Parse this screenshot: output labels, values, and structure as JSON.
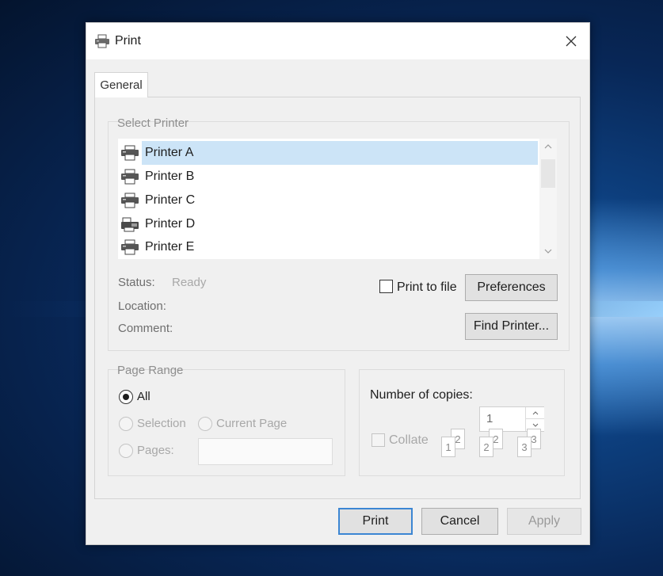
{
  "window": {
    "title": "Print",
    "icon": "printer-icon",
    "close_icon": "close-icon"
  },
  "tabs": [
    {
      "label": "General",
      "active": true
    }
  ],
  "select_printer": {
    "label": "Select Printer",
    "printers": [
      {
        "name": "Printer A",
        "selected": true
      },
      {
        "name": "Printer B",
        "selected": false
      },
      {
        "name": "Printer C",
        "selected": false
      },
      {
        "name": "Printer D",
        "selected": false
      },
      {
        "name": "Printer E",
        "selected": false
      }
    ],
    "status_label": "Status:",
    "status_value": "Ready",
    "location_label": "Location:",
    "comment_label": "Comment:",
    "print_to_file_label": "Print to file",
    "print_to_file_checked": false,
    "preferences_label": "Preferences",
    "find_printer_label": "Find Printer..."
  },
  "page_range": {
    "label": "Page Range",
    "all_label": "All",
    "selection_label": "Selection",
    "current_page_label": "Current Page",
    "pages_label": "Pages:",
    "selected": "All"
  },
  "copies": {
    "label": "Number of copies:",
    "value": "1",
    "collate_label": "Collate",
    "collate_checked": false,
    "collate_pages": [
      [
        "1",
        "2"
      ],
      [
        "2",
        "2"
      ],
      [
        "3",
        "3"
      ]
    ]
  },
  "footer": {
    "print_label": "Print",
    "cancel_label": "Cancel",
    "apply_label": "Apply"
  },
  "colors": {
    "selection": "#cce4f7",
    "default_button_border": "#3c86d3",
    "dialog_bg": "#f0f0f0"
  }
}
